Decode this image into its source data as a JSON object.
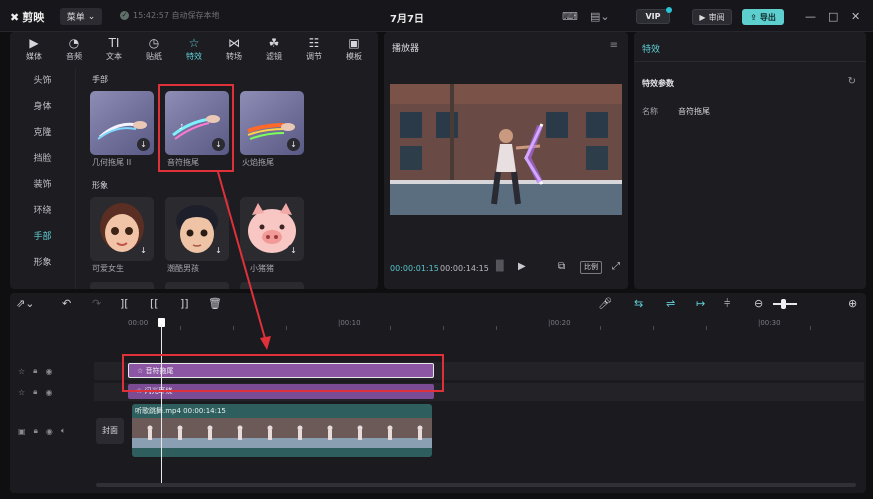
{
  "titlebar": {
    "app_name": "剪映",
    "menu_label": "菜单",
    "save_status": "15:42:57 自动保存本地",
    "project_title": "7月7日",
    "vip_label": "VIP",
    "review_label": "审阅",
    "export_label": "导出"
  },
  "library": {
    "tabs": [
      {
        "label": "媒体",
        "icon": "media-icon"
      },
      {
        "label": "音频",
        "icon": "audio-icon"
      },
      {
        "label": "文本",
        "icon": "text-icon"
      },
      {
        "label": "贴纸",
        "icon": "sticker-icon"
      },
      {
        "label": "特效",
        "icon": "effects-icon",
        "active": true
      },
      {
        "label": "转场",
        "icon": "transition-icon"
      },
      {
        "label": "滤镜",
        "icon": "filter-icon"
      },
      {
        "label": "调节",
        "icon": "adjust-icon"
      },
      {
        "label": "模板",
        "icon": "template-icon"
      }
    ],
    "categories": [
      "头饰",
      "身体",
      "克隆",
      "挡脸",
      "装饰",
      "环绕",
      "手部",
      "形象"
    ],
    "active_category": "手部",
    "sections": [
      {
        "title": "手部",
        "items": [
          {
            "label": "几何拖尾 II",
            "type": "effect"
          },
          {
            "label": "音符拖尾",
            "type": "effect",
            "selected": true
          },
          {
            "label": "火焰拖尾",
            "type": "effect"
          }
        ]
      },
      {
        "title": "形象",
        "items": [
          {
            "label": "可爱女生",
            "type": "avatar-girl"
          },
          {
            "label": "潮酷男孩",
            "type": "avatar-boy"
          },
          {
            "label": "小猪猪",
            "type": "avatar-pig"
          }
        ]
      }
    ]
  },
  "player": {
    "title": "播放器",
    "current_time": "00:00:01:15",
    "total_time": "00:00:14:15",
    "ratio_label": "比例"
  },
  "properties": {
    "title": "特效",
    "params_title": "特效参数",
    "name_label": "名称",
    "name_value": "音符拖尾"
  },
  "timeline": {
    "ruler_labels": [
      "00:00",
      "|00:10",
      "|00:20",
      "|00:30"
    ],
    "effect_clip_1": "音符拖尾",
    "effect_clip_2": "闪光环绕",
    "cover_label": "封面",
    "video_clip_label": "听歌跳舞.mp4  00:00:14:15"
  },
  "colors": {
    "accent": "#5fd0d6",
    "highlight": "#e0313a",
    "effect_clip": "#8c56a4",
    "video_clip": "#2e5f5e"
  }
}
